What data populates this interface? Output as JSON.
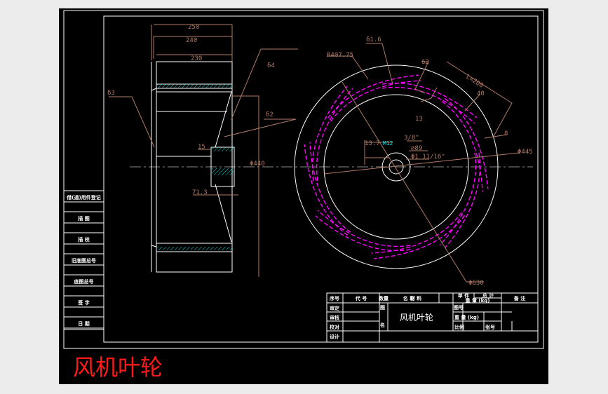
{
  "drawing_title": "风机叶轮",
  "title_color": "#ff1a1a",
  "colors": {
    "background": "#000000",
    "outline": "#ffffff",
    "dimension": "#b07a66",
    "blade": "#ff00ff",
    "hatch": "#00e5e5",
    "center_line": "#888888",
    "app_frame": "#ececec"
  },
  "side_view_dims": {
    "d250": "250",
    "d240": "240",
    "d230": "230",
    "t4": "δ4",
    "t3": "δ3",
    "t2": "δ2",
    "d15": "15",
    "dia440": "Φ440",
    "d71": "71.3"
  },
  "front_view_dims": {
    "r407": "R407.75",
    "t16": "δ1.6",
    "a62": "62",
    "len": "L=200",
    "w40": "40",
    "l13": "13",
    "w8": "8",
    "d445": "Φ445",
    "d137": "13.7",
    "m12": "M12",
    "f38": "3/8\"",
    "d89": "⌀89",
    "f116": "Φ1 11/16\"",
    "d630": "Φ630"
  },
  "left_table": [
    "借(通)用件登记",
    "描 图",
    "描 校",
    "旧底图总号",
    "底图总号",
    "签 字",
    "日 期"
  ],
  "title_block": {
    "headers": [
      "序号",
      "代 号",
      "名 称",
      "数量",
      "材 料",
      "单 件",
      "总 计",
      "重 量 (kg)",
      "备 注"
    ],
    "roles": [
      "审定",
      "审核",
      "校对",
      "设计"
    ],
    "tu": "图",
    "ming": "名",
    "name": "风机叶轮",
    "tu_hao": "图号",
    "weight": "重 量 (kg)",
    "scale": "比例",
    "sheet": "张号"
  }
}
